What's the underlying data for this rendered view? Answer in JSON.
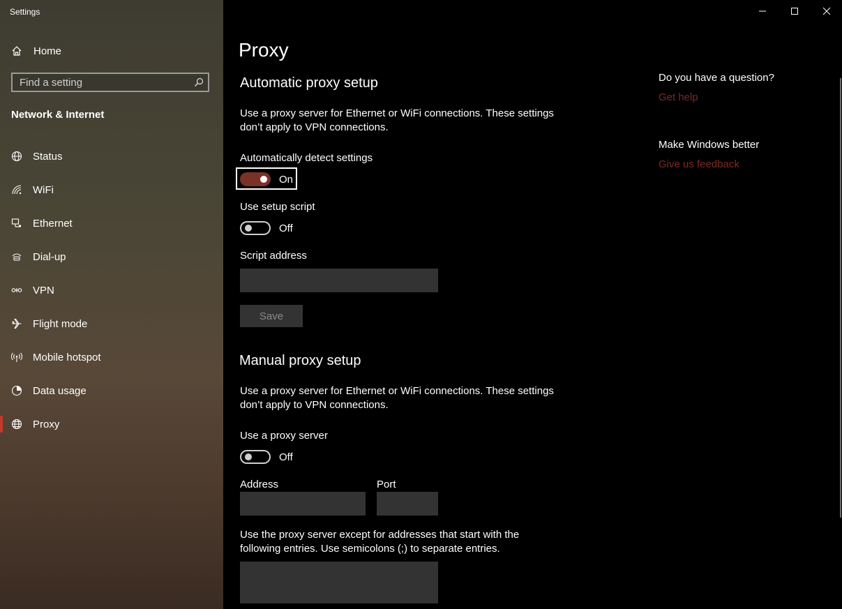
{
  "window": {
    "title": "Settings"
  },
  "sidebar": {
    "home_label": "Home",
    "search_placeholder": "Find a setting",
    "section_title": "Network & Internet",
    "items": [
      {
        "label": "Status",
        "icon": "globe-status-icon"
      },
      {
        "label": "WiFi",
        "icon": "wifi-icon"
      },
      {
        "label": "Ethernet",
        "icon": "ethernet-icon"
      },
      {
        "label": "Dial-up",
        "icon": "dialup-icon"
      },
      {
        "label": "VPN",
        "icon": "vpn-icon"
      },
      {
        "label": "Flight mode",
        "icon": "airplane-icon"
      },
      {
        "label": "Mobile hotspot",
        "icon": "hotspot-icon"
      },
      {
        "label": "Data usage",
        "icon": "data-usage-icon"
      },
      {
        "label": "Proxy",
        "icon": "globe-icon",
        "selected": true
      }
    ]
  },
  "main": {
    "title": "Proxy",
    "auto": {
      "heading": "Automatic proxy setup",
      "description": "Use a proxy server for Ethernet or WiFi connections. These settings don’t apply to VPN connections.",
      "detect_label": "Automatically detect settings",
      "detect_state": "On",
      "script_label": "Use setup script",
      "script_state": "Off",
      "address_label": "Script address",
      "address_value": "",
      "save_label": "Save"
    },
    "manual": {
      "heading": "Manual proxy setup",
      "description": "Use a proxy server for Ethernet or WiFi connections. These settings don’t apply to VPN connections.",
      "use_label": "Use a proxy server",
      "use_state": "Off",
      "address_label": "Address",
      "address_value": "",
      "port_label": "Port",
      "port_value": "",
      "exceptions_text": "Use the proxy server except for addresses that start with the following entries. Use semicolons (;) to separate entries.",
      "exceptions_value": ""
    }
  },
  "help": {
    "question": "Do you have a question?",
    "get_help": "Get help",
    "better": "Make Windows better",
    "feedback": "Give us feedback"
  },
  "colors": {
    "accent": "#c0392b",
    "toggle_on": "#7a3128",
    "link": "#7d2a22"
  }
}
